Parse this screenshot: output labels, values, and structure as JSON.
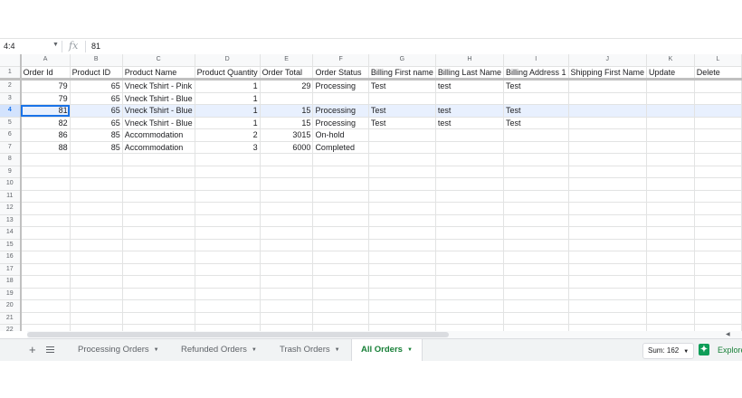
{
  "formula_bar": {
    "cell_ref": "4:4",
    "fx": "fx",
    "value": "81"
  },
  "columns": [
    "A",
    "B",
    "C",
    "D",
    "E",
    "F",
    "G",
    "H",
    "I",
    "J",
    "K",
    "L"
  ],
  "rows": [
    [
      "1",
      "Order Id",
      "Product ID",
      "Product Name",
      "Product Quantity",
      "Order Total",
      "Order Status",
      "Billing First name",
      "Billing Last Name",
      "Billing Address 1",
      "Shipping First Name",
      "Update",
      "Delete"
    ],
    [
      "2",
      "79",
      "65",
      "Vneck Tshirt - Pink",
      "1",
      "29",
      "Processing",
      "Test",
      "test",
      "Test",
      "",
      "",
      ""
    ],
    [
      "3",
      "79",
      "65",
      "Vneck Tshirt - Blue",
      "1",
      "",
      "",
      "",
      "",
      "",
      "",
      "",
      ""
    ],
    [
      "4",
      "81",
      "65",
      "Vneck Tshirt - Blue",
      "1",
      "15",
      "Processing",
      "Test",
      "test",
      "Test",
      "",
      "",
      ""
    ],
    [
      "5",
      "82",
      "65",
      "Vneck Tshirt - Blue",
      "1",
      "15",
      "Processing",
      "Test",
      "test",
      "Test",
      "",
      "",
      ""
    ],
    [
      "6",
      "86",
      "85",
      "Accommodation",
      "2",
      "3015",
      "On-hold",
      "",
      "",
      "",
      "",
      "",
      ""
    ],
    [
      "7",
      "88",
      "85",
      "Accommodation",
      "3",
      "6000",
      "Completed",
      "",
      "",
      "",
      "",
      "",
      ""
    ],
    [
      "8",
      "",
      "",
      "",
      "",
      "",
      "",
      "",
      "",
      "",
      "",
      "",
      ""
    ],
    [
      "9",
      "",
      "",
      "",
      "",
      "",
      "",
      "",
      "",
      "",
      "",
      "",
      ""
    ],
    [
      "10",
      "",
      "",
      "",
      "",
      "",
      "",
      "",
      "",
      "",
      "",
      "",
      ""
    ],
    [
      "11",
      "",
      "",
      "",
      "",
      "",
      "",
      "",
      "",
      "",
      "",
      "",
      ""
    ],
    [
      "12",
      "",
      "",
      "",
      "",
      "",
      "",
      "",
      "",
      "",
      "",
      "",
      ""
    ],
    [
      "13",
      "",
      "",
      "",
      "",
      "",
      "",
      "",
      "",
      "",
      "",
      "",
      ""
    ],
    [
      "14",
      "",
      "",
      "",
      "",
      "",
      "",
      "",
      "",
      "",
      "",
      "",
      ""
    ],
    [
      "15",
      "",
      "",
      "",
      "",
      "",
      "",
      "",
      "",
      "",
      "",
      "",
      ""
    ],
    [
      "16",
      "",
      "",
      "",
      "",
      "",
      "",
      "",
      "",
      "",
      "",
      "",
      ""
    ],
    [
      "17",
      "",
      "",
      "",
      "",
      "",
      "",
      "",
      "",
      "",
      "",
      "",
      ""
    ],
    [
      "18",
      "",
      "",
      "",
      "",
      "",
      "",
      "",
      "",
      "",
      "",
      "",
      ""
    ],
    [
      "19",
      "",
      "",
      "",
      "",
      "",
      "",
      "",
      "",
      "",
      "",
      "",
      ""
    ],
    [
      "20",
      "",
      "",
      "",
      "",
      "",
      "",
      "",
      "",
      "",
      "",
      "",
      ""
    ],
    [
      "21",
      "",
      "",
      "",
      "",
      "",
      "",
      "",
      "",
      "",
      "",
      "",
      ""
    ],
    [
      "22",
      "",
      "",
      "",
      "",
      "",
      "",
      "",
      "",
      "",
      "",
      "",
      ""
    ]
  ],
  "numeric_columns": [
    0,
    1,
    3,
    4
  ],
  "selected_row": 4,
  "tabs": {
    "add": "+",
    "sheets": [
      {
        "label": "Processing Orders",
        "active": false
      },
      {
        "label": "Refunded Orders",
        "active": false
      },
      {
        "label": "Trash Orders",
        "active": false
      },
      {
        "label": "All Orders",
        "active": true
      }
    ],
    "caret": "▼"
  },
  "status": {
    "sum": "Sum: 162",
    "explore": "Explore",
    "explore_icon": "explore-icon"
  },
  "colors": {
    "accent": "#1a73e8",
    "active_tab": "#188038",
    "selection": "#e8f0fe"
  }
}
